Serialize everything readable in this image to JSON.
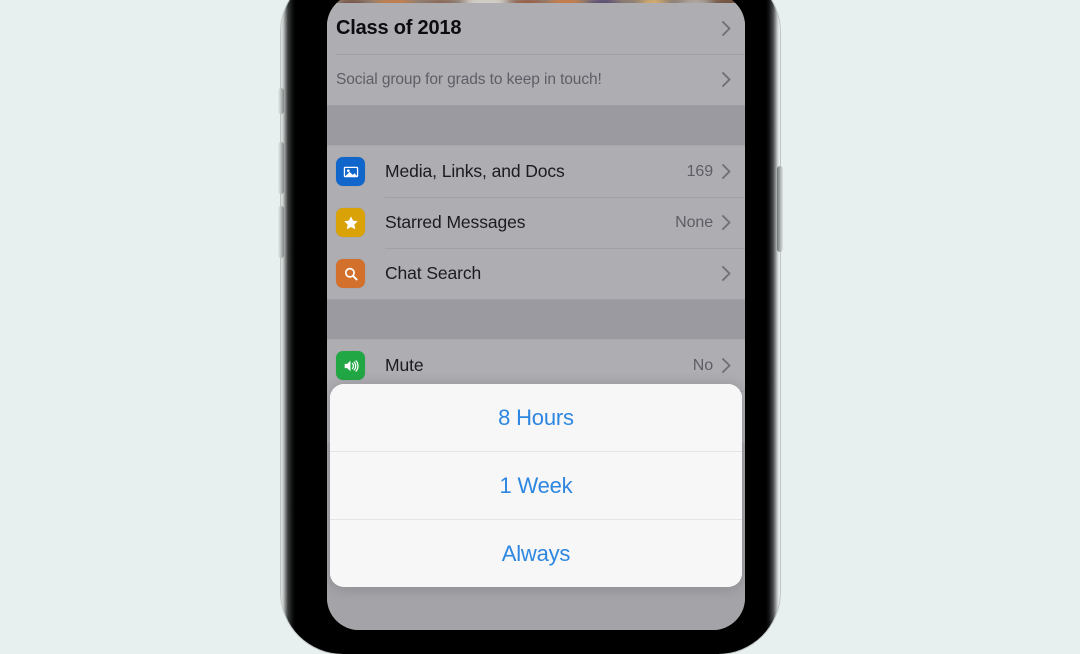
{
  "device": {
    "platform": "iOS",
    "screen_background": "#8e8e93"
  },
  "colors": {
    "page_background": "#e8f0ef",
    "accent_blue": "#2d86e0",
    "dim_overlay": "#a3a3a8",
    "sheet_background": "#f7f7f8",
    "icon_media": "#1166cc",
    "icon_starred": "#d9a206",
    "icon_search": "#d2702c",
    "icon_mute": "#21a845",
    "icon_next_partial": "#b0399d"
  },
  "app": {
    "group_header": {
      "title": "Class of 2018",
      "chevron": "chevron-right-icon"
    },
    "group_description": {
      "text": "Social group for grads to keep in touch!",
      "chevron": "chevron-right-icon"
    },
    "sections": [
      {
        "rows": [
          {
            "icon": "media-photo-icon",
            "icon_color": "#1166cc",
            "label": "Media, Links, and Docs",
            "value": "169",
            "chevron": "chevron-right-icon"
          },
          {
            "icon": "star-icon",
            "icon_color": "#d9a206",
            "label": "Starred Messages",
            "value": "None",
            "chevron": "chevron-right-icon"
          },
          {
            "icon": "magnifier-icon",
            "icon_color": "#d2702c",
            "label": "Chat Search",
            "value": "",
            "chevron": "chevron-right-icon"
          }
        ]
      },
      {
        "rows": [
          {
            "icon": "speaker-mute-icon",
            "icon_color": "#21a845",
            "label": "Mute",
            "value": "No",
            "chevron": "chevron-right-icon"
          }
        ]
      }
    ]
  },
  "action_sheet": {
    "options": [
      {
        "label": "8 Hours"
      },
      {
        "label": "1 Week"
      },
      {
        "label": "Always"
      }
    ]
  },
  "hardware_buttons": {
    "silent_switch": "silent-switch",
    "volume_up": "volume-up-button",
    "volume_down": "volume-down-button",
    "power": "power-button"
  }
}
